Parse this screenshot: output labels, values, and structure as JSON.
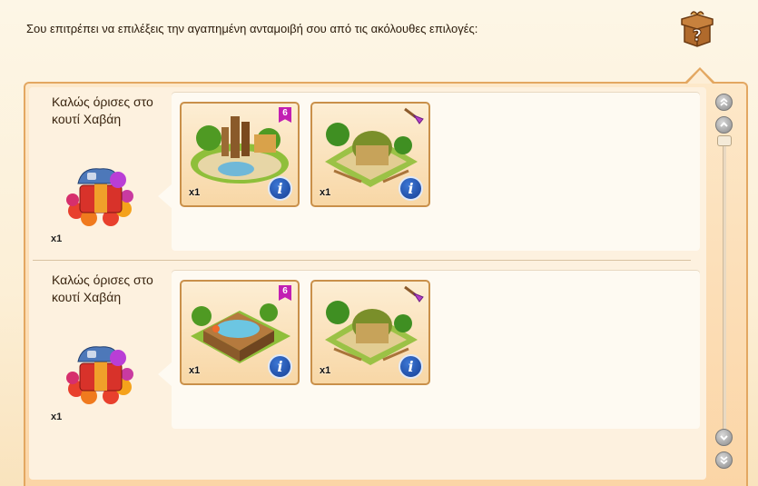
{
  "instruction": "Σου επιτρέπει να επιλέξεις την αγαπημένη ανταμοιβή σου από τις ακόλουθες επιλογές:",
  "rows": [
    {
      "title": "Καλώς όρισες στο κουτί Χαβάη",
      "quantity": "x1",
      "rewards": [
        {
          "quantity": "x1",
          "badge": "6",
          "info": "i",
          "scene": "tiki-totem-pond"
        },
        {
          "quantity": "x1",
          "badge": "",
          "info": "i",
          "scene": "hut-with-palms"
        }
      ]
    },
    {
      "title": "Καλώς όρισες στο κουτί Χαβάη",
      "quantity": "x1",
      "rewards": [
        {
          "quantity": "x1",
          "badge": "6",
          "info": "i",
          "scene": "hot-tub-deck"
        },
        {
          "quantity": "x1",
          "badge": "",
          "info": "i",
          "scene": "hut-with-palms"
        }
      ]
    }
  ],
  "colors": {
    "frame": "#e3a761",
    "badge": "#c21fb3",
    "info": "#1f53b5"
  }
}
